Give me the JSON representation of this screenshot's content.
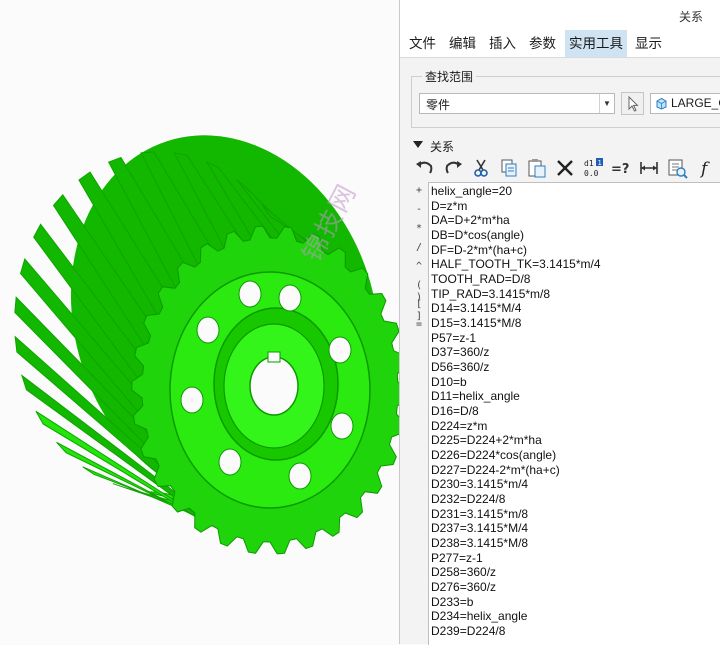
{
  "viewport": {
    "model_color": "#22e60a",
    "model_color_dark": "#12b800",
    "watermark_text": "锦技网"
  },
  "window": {
    "title": "关系"
  },
  "menu": {
    "items": [
      {
        "label": "文件",
        "active": false
      },
      {
        "label": "编辑",
        "active": false
      },
      {
        "label": "插入",
        "active": false
      },
      {
        "label": "参数",
        "active": false
      },
      {
        "label": "实用工具",
        "active": true
      },
      {
        "label": "显示",
        "active": false
      }
    ]
  },
  "scope": {
    "group_label": "查找范围",
    "select_value": "零件",
    "model_name": "LARGE_G"
  },
  "relations": {
    "section_label": "关系",
    "toolbar_icons": [
      "undo-icon",
      "redo-icon",
      "cut-icon",
      "copy-icon",
      "paste-icon",
      "delete-icon",
      "toggle-display-icon",
      "evaluate-icon",
      "insert-dimension-icon",
      "sort-icon",
      "function-icon"
    ],
    "toolbar_texts": {
      "evaluate": "=?",
      "function": "f"
    },
    "side_ops": [
      "+",
      "-",
      "*",
      "/",
      "^",
      "( )",
      "[ ]",
      "="
    ],
    "lines": [
      "helix_angle=20",
      "D=z*m",
      "DA=D+2*m*ha",
      "DB=D*cos(angle)",
      "DF=D-2*m*(ha+c)",
      "HALF_TOOTH_TK=3.1415*m/4",
      "TOOTH_RAD=D/8",
      "TIP_RAD=3.1415*m/8",
      "D14=3.1415*M/4",
      "D15=3.1415*M/8",
      "P57=z-1",
      "D37=360/z",
      "D56=360/z",
      "D10=b",
      "D11=helix_angle",
      "D16=D/8",
      "D224=z*m",
      "D225=D224+2*m*ha",
      "D226=D224*cos(angle)",
      "D227=D224-2*m*(ha+c)",
      "D230=3.1415*m/4",
      "D232=D224/8",
      "D231=3.1415*m/8",
      "D237=3.1415*M/4",
      "D238=3.1415*M/8",
      "P277=z-1",
      "D258=360/z",
      "D276=360/z",
      "D233=b",
      "D234=helix_angle",
      "D239=D224/8"
    ]
  }
}
